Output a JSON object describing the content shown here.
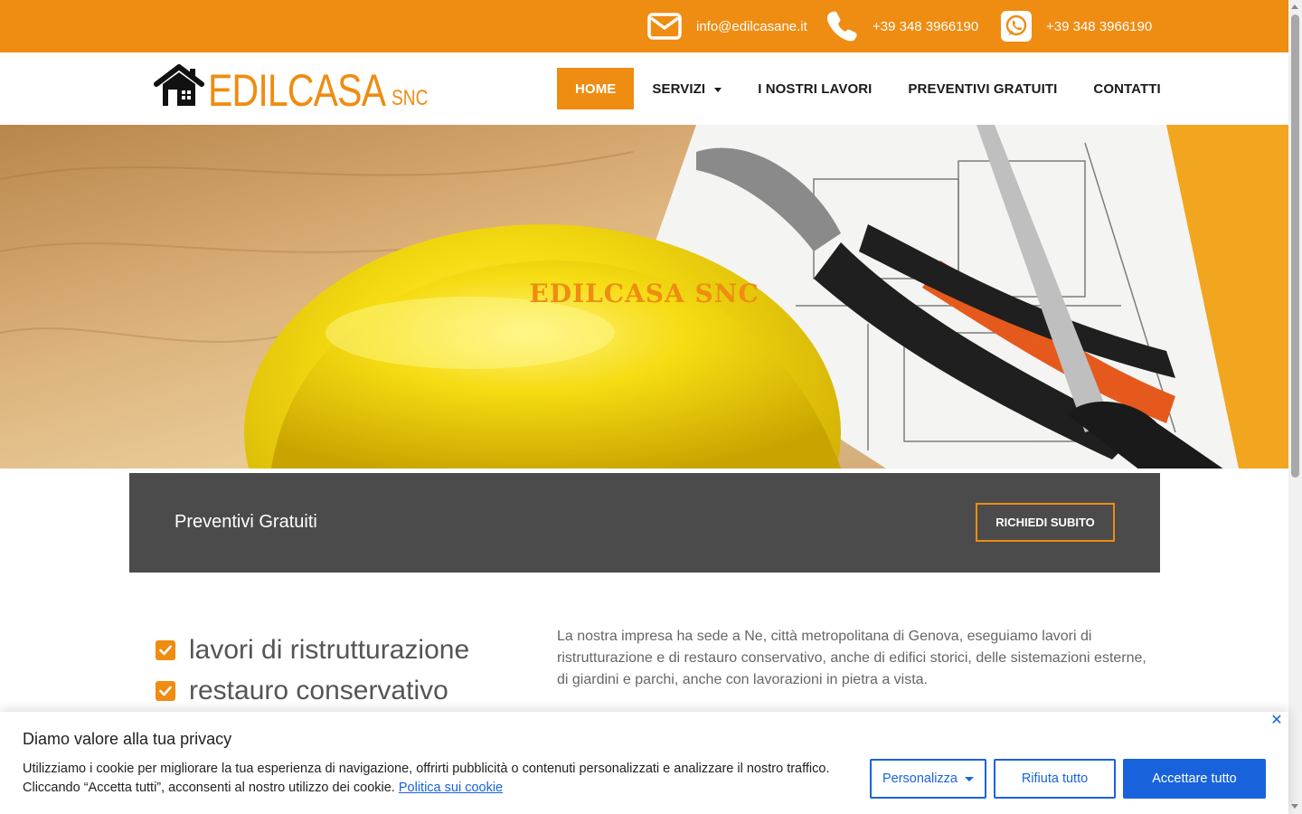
{
  "topbar": {
    "email": "info@edilcasane.it",
    "phone": "+39 348 3966190",
    "whatsapp": "+39 348 3966190",
    "background": "#ef8c12"
  },
  "logo": {
    "name": "EDILCASA",
    "suffix": "SNC",
    "icon": "house-icon"
  },
  "nav": {
    "items": [
      {
        "label": "HOME",
        "active": true
      },
      {
        "label": "SERVIZI",
        "dropdown": true
      },
      {
        "label": "I NOSTRI LAVORI"
      },
      {
        "label": "PREVENTIVI GRATUITI"
      },
      {
        "label": "CONTATTI"
      }
    ]
  },
  "hero": {
    "title": "EDILCASA SNC"
  },
  "cta": {
    "text": "Preventivi Gratuiti",
    "button": "RICHIEDI SUBITO"
  },
  "services": {
    "items": [
      "lavori di ristrutturazione",
      "restauro conservativo"
    ]
  },
  "about": {
    "text": "La nostra impresa ha sede a Ne, città metropolitana di Genova, eseguiamo lavori di ristrutturazione e di restauro conservativo, anche di edifici storici, delle sistemazioni esterne, di giardini e parchi, anche con lavorazioni in pietra a vista."
  },
  "cookie": {
    "title": "Diamo valore alla tua privacy",
    "body": "Utilizziamo i cookie per migliorare la tua esperienza di navigazione, offrirti pubblicità o contenuti personalizzati e analizzare il nostro traffico. Cliccando “Accetta tutti”, acconsenti al nostro utilizzo dei cookie.",
    "link": "Politica sui cookie",
    "customize": "Personalizza",
    "reject": "Rifiuta tutto",
    "accept": "Accettare tutto"
  },
  "colors": {
    "accent": "#ef8c12",
    "dark_band": "#4b4b4b",
    "cookie_blue": "#1863dc"
  }
}
